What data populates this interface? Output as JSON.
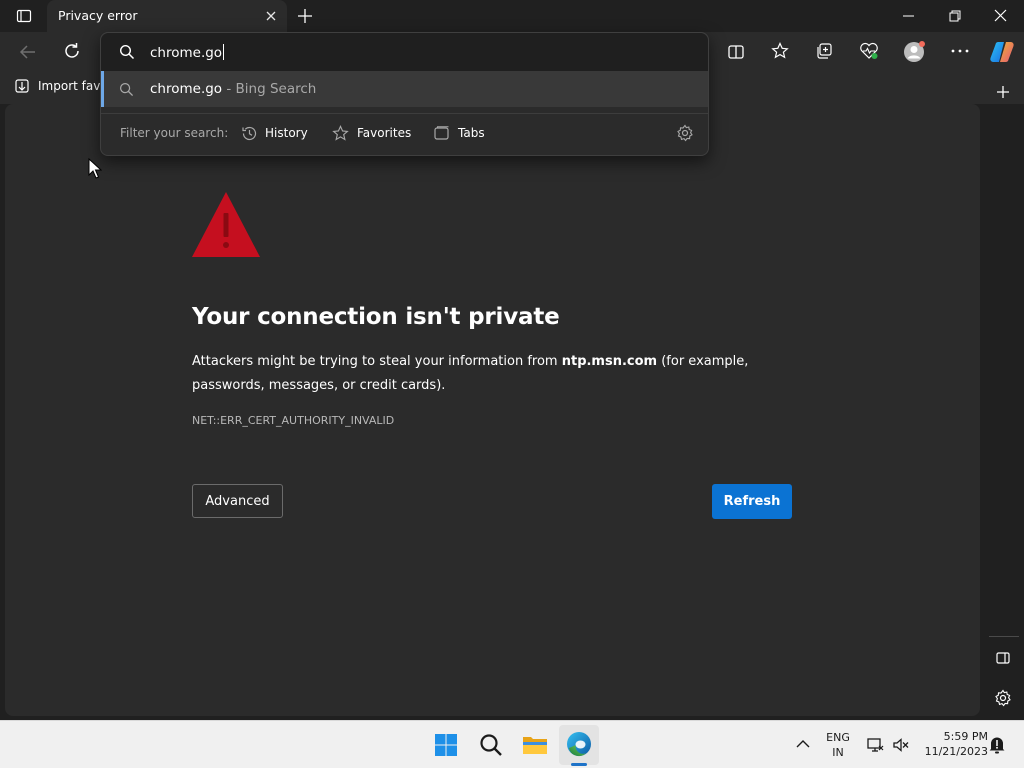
{
  "browser": {
    "tab_title": "Privacy error",
    "favorites_bar": {
      "import_label": "Import favo"
    },
    "omnibox": {
      "input_value": "chrome.go",
      "suggestion": {
        "text": "chrome.go",
        "source": " - Bing Search"
      },
      "filter": {
        "label": "Filter your search:",
        "chips": [
          {
            "label": "History",
            "icon": "history-icon"
          },
          {
            "label": "Favorites",
            "icon": "star-icon"
          },
          {
            "label": "Tabs",
            "icon": "tabs-icon"
          }
        ]
      }
    }
  },
  "error_page": {
    "heading": "Your connection isn't private",
    "body_prefix": "Attackers might be trying to steal your information from ",
    "body_domain": "ntp.msn.com",
    "body_suffix": " (for example, passwords, messages, or credit cards).",
    "error_code": "NET::ERR_CERT_AUTHORITY_INVALID",
    "advanced_label": "Advanced",
    "refresh_label": "Refresh",
    "warning_color": "#c50f1f",
    "accent_color": "#0b73d3"
  },
  "taskbar": {
    "language_top": "ENG",
    "language_bottom": "IN",
    "time": "5:59 PM",
    "date": "11/21/2023",
    "apps": [
      "windows-start-icon",
      "search-icon",
      "file-explorer-icon",
      "edge-icon"
    ]
  }
}
